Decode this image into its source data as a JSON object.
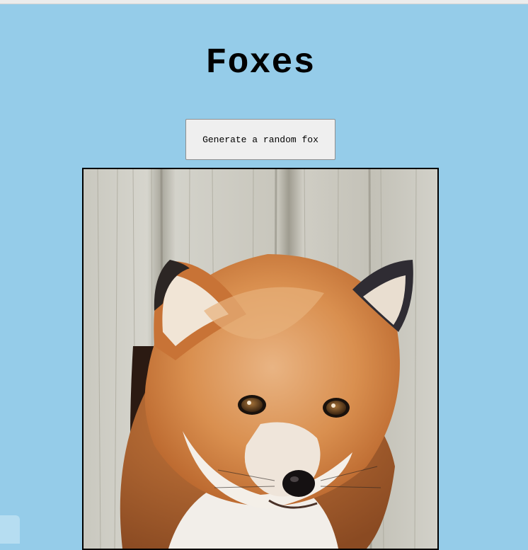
{
  "page": {
    "title": "Foxes",
    "background_color": "#95cce9"
  },
  "button": {
    "label": "Generate a random fox"
  },
  "image": {
    "subject": "red fox peeking through a hole in a weathered wooden fence",
    "icon": "fox-photo"
  }
}
